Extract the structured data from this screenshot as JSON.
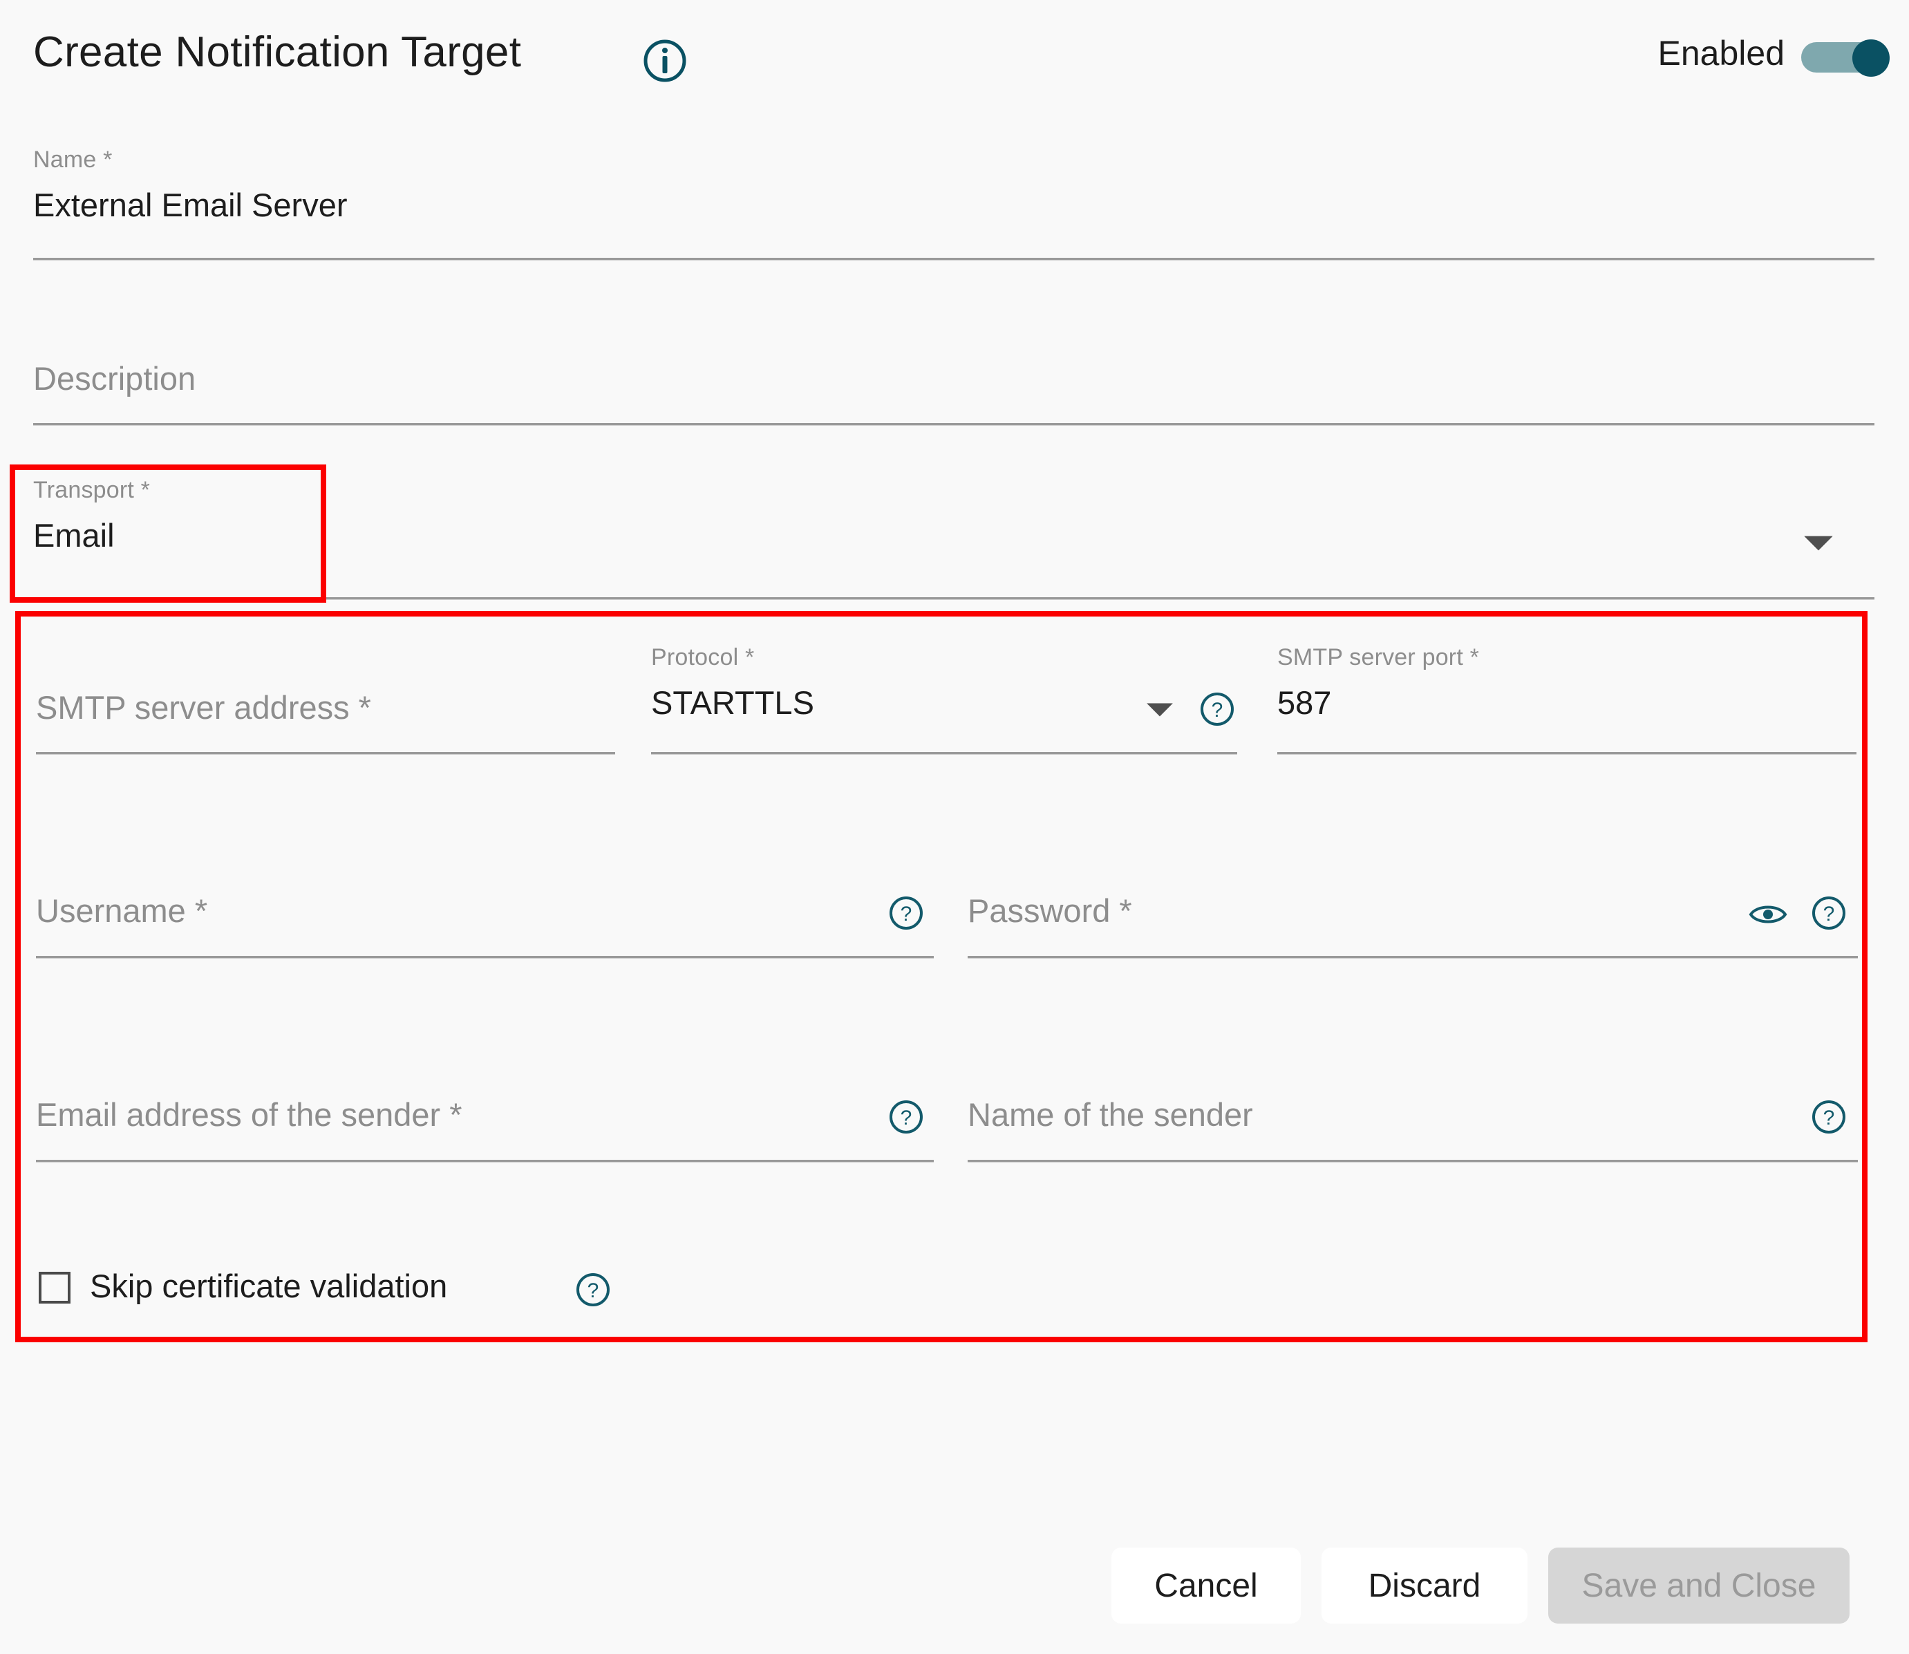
{
  "header": {
    "title": "Create Notification Target",
    "info_icon": "info-circle-icon",
    "enabled_label": "Enabled",
    "enabled_state": "on",
    "accent_teal": "#0a5163",
    "toggle_track": "#7fa8ae"
  },
  "form": {
    "name": {
      "label": "Name *",
      "value": "External Email Server",
      "placeholder": "Name *"
    },
    "description": {
      "label": "",
      "value": "",
      "placeholder": "Description"
    },
    "transport": {
      "label": "Transport *",
      "value": "Email",
      "dropdown_icon": "chevron-down-icon",
      "options": [
        "Email"
      ]
    },
    "smtp_server_address": {
      "label": "",
      "value": "",
      "placeholder": "SMTP server address *"
    },
    "protocol": {
      "label": "Protocol *",
      "value": "STARTTLS",
      "dropdown_icon": "chevron-down-icon",
      "help_icon": "help-circle-icon",
      "options": [
        "STARTTLS"
      ]
    },
    "smtp_server_port": {
      "label": "SMTP server port *",
      "value": "587",
      "placeholder": "SMTP server port *"
    },
    "username": {
      "label": "",
      "value": "",
      "placeholder": "Username *",
      "help_icon": "help-circle-icon"
    },
    "password": {
      "label": "",
      "value": "",
      "placeholder": "Password *",
      "reveal_icon": "eye-icon",
      "help_icon": "help-circle-icon"
    },
    "sender_email": {
      "label": "",
      "value": "",
      "placeholder": "Email address of the sender *",
      "help_icon": "help-circle-icon"
    },
    "sender_name": {
      "label": "",
      "value": "",
      "placeholder": "Name of the sender",
      "help_icon": "help-circle-icon"
    },
    "skip_certificate_validation": {
      "label": "Skip certificate validation",
      "checked": false,
      "help_icon": "help-circle-icon"
    }
  },
  "annotations": {
    "highlight_color": "#fb0000",
    "boxes": [
      "transport-field",
      "email-transport-settings"
    ]
  },
  "footer": {
    "cancel_label": "Cancel",
    "discard_label": "Discard",
    "save_label": "Save and Close",
    "save_disabled": true
  }
}
